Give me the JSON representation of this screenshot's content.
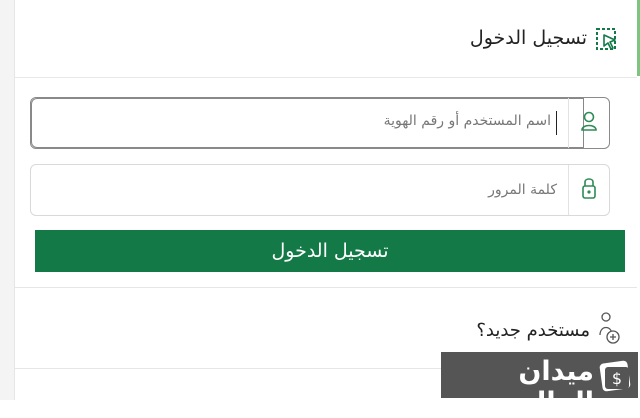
{
  "header": {
    "title": "تسجيل الدخول",
    "icon": "dashed-cursor-icon"
  },
  "form": {
    "username_placeholder": "اسم المستخدم أو رقم الهوية",
    "username_icon": "user-icon",
    "password_placeholder": "كلمة المرور",
    "password_icon": "lock-icon",
    "submit_label": "تسجيل الدخول"
  },
  "new_user": {
    "label": "مستخدم جديد؟",
    "icon": "add-user-icon"
  },
  "watermark": {
    "text": "ميدان المال",
    "icon": "wallet-icon"
  },
  "colors": {
    "primary": "#137a47",
    "accent": "#7cc47f",
    "watermark_bg": "#555555"
  }
}
